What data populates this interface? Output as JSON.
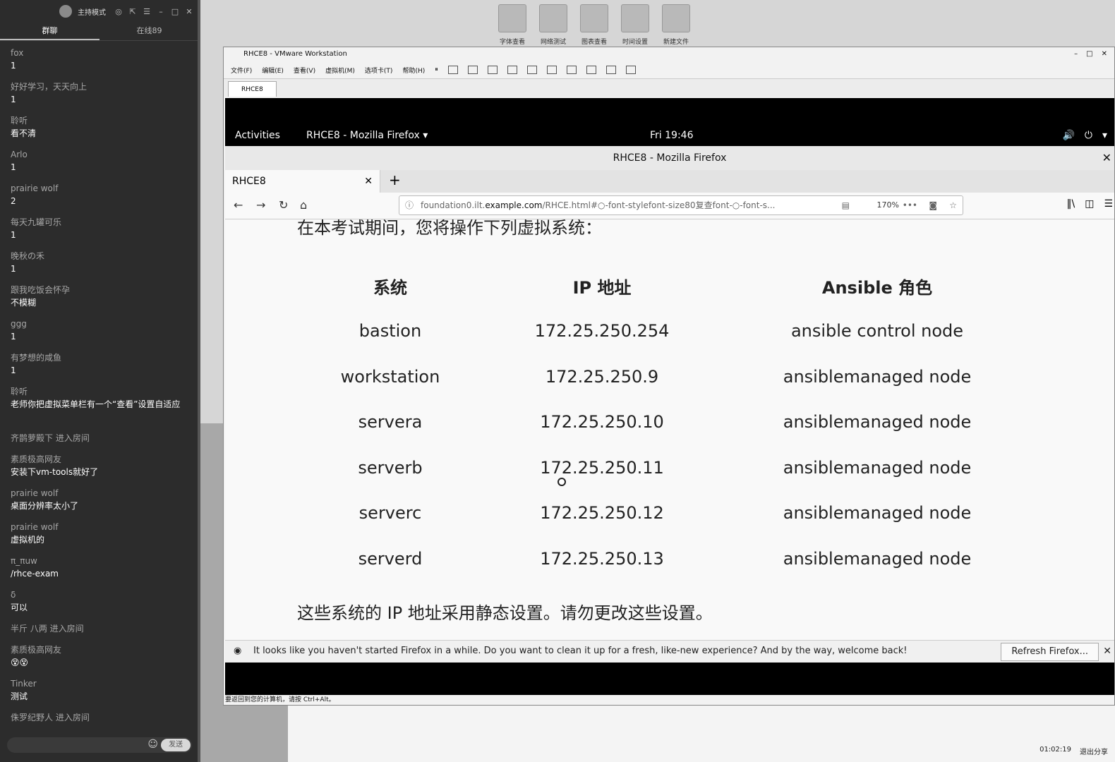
{
  "chat": {
    "top": {
      "mode": "主持模式"
    },
    "tabs": [
      {
        "label": "群聊"
      },
      {
        "label": "在线89"
      }
    ],
    "messages": [
      {
        "user": "fox",
        "text": "1"
      },
      {
        "user": "好好学习，天天向上",
        "text": "1"
      },
      {
        "user": "聆听",
        "text": "看不清"
      },
      {
        "user": "Arlo",
        "text": "1"
      },
      {
        "user": "prairie wolf",
        "text": "2"
      },
      {
        "user": "每天九罐可乐",
        "text": "1"
      },
      {
        "user": "晚秋の禾",
        "text": "1"
      },
      {
        "user": "跟我吃饭会怀孕",
        "text": "不模糊"
      },
      {
        "user": "ggg",
        "text": "1"
      },
      {
        "user": "有梦想的咸鱼",
        "text": "1"
      },
      {
        "user": "聆听",
        "text": "老师你把虚拟菜单栏有一个“查看”设置自适应"
      },
      {
        "user": "齐鹊萝殿下 进入房间",
        "text": ""
      },
      {
        "user": "素质极高网友",
        "text": "安装下vm-tools就好了"
      },
      {
        "user": "prairie wolf",
        "text": "桌面分辨率太小了"
      },
      {
        "user": "prairie wolf",
        "text": "虚拟机的"
      },
      {
        "user": "π_πuw",
        "text": "/rhce-exam"
      },
      {
        "user": "δ",
        "text": "可以"
      },
      {
        "user": "半斤 八两 进入房间",
        "text": ""
      },
      {
        "user": "素质极高网友",
        "text": "😵😵"
      },
      {
        "user": "Tinker",
        "text": "测试"
      },
      {
        "user": "侏罗纪野人 进入房间",
        "text": ""
      }
    ],
    "send_label": "发送"
  },
  "desktop": {
    "icons": [
      {
        "label": "字体查看"
      },
      {
        "label": "网络测试"
      },
      {
        "label": "图表查看"
      },
      {
        "label": "时间设置"
      },
      {
        "label": "新建文件"
      }
    ],
    "recording": {
      "time": "01:02:19",
      "exit": "退出分享"
    }
  },
  "vmware": {
    "title": "RHCE8 - VMware Workstation",
    "menu": [
      "文件(F)",
      "编辑(E)",
      "查看(V)",
      "虚拟机(M)",
      "选项卡(T)",
      "帮助(H)"
    ],
    "tab": "RHCE8",
    "status": "要返回到您的计算机，请按 Ctrl+Alt。"
  },
  "gnome": {
    "activities": "Activities",
    "app": "RHCE8 - Mozilla Firefox ▾",
    "clock": "Fri 19:46"
  },
  "firefox": {
    "window_title": "RHCE8 - Mozilla Firefox",
    "tab_title": "RHCE8",
    "url_prefix": "foundation0.ilt.",
    "url_host": "example.com",
    "url_rest": "/RHCE.html#○-font-stylefont-size80复查font-○-font-s...",
    "zoom": "170%",
    "notice": "It looks like you haven't started Firefox in a while. Do you want to clean it up for a fresh, like-new experience? And by the way, welcome back!",
    "refresh_label": "Refresh Firefox..."
  },
  "page": {
    "intro": "在本考试期间，您将操作下列虚拟系统：",
    "headers": [
      "系统",
      "IP 地址",
      "Ansible 角色"
    ],
    "rows": [
      [
        "bastion",
        "172.25.250.254",
        "ansible control node"
      ],
      [
        "workstation",
        "172.25.250.9",
        "ansiblemanaged node"
      ],
      [
        "servera",
        "172.25.250.10",
        "ansiblemanaged node"
      ],
      [
        "serverb",
        "172.25.250.11",
        "ansiblemanaged node"
      ],
      [
        "serverc",
        "172.25.250.12",
        "ansiblemanaged node"
      ],
      [
        "serverd",
        "172.25.250.13",
        "ansiblemanaged node"
      ]
    ],
    "outro": "这些系统的 IP 地址采用静态设置。请勿更改这些设置。"
  }
}
